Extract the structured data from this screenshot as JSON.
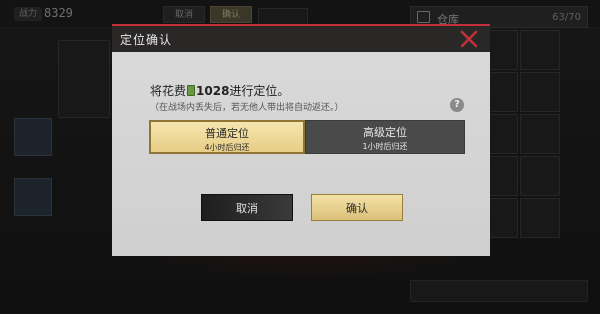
{
  "background": {
    "power_label": "战力",
    "power_value": "8329",
    "cancel_label": "取消",
    "confirm_label": "确认",
    "warehouse": {
      "title": "仓库",
      "count": "63/70"
    }
  },
  "dialog": {
    "title": "定位确认",
    "cost_prefix": "将花费",
    "cost_amount": "1028",
    "cost_suffix": "进行定位。",
    "note": "（在战场内丢失后，若无他人带出将自动返还。）",
    "help_symbol": "?",
    "options": [
      {
        "title": "普通定位",
        "subtitle": "4小时后归还",
        "selected": true
      },
      {
        "title": "高级定位",
        "subtitle": "1小时后归还",
        "selected": false
      }
    ],
    "cancel_label": "取消",
    "confirm_label": "确认"
  },
  "colors": {
    "accent_red": "#c2303a",
    "gold": "#e7cd85",
    "dark_option": "#4a4a4a"
  }
}
